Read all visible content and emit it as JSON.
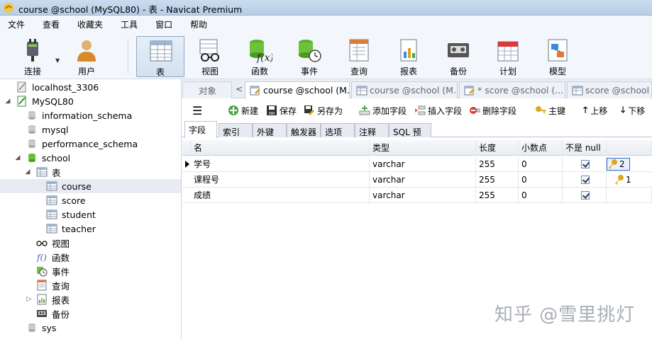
{
  "window": {
    "title": "course @school (MySQL80) - 表 - Navicat Premium"
  },
  "menu": [
    "文件",
    "查看",
    "收藏夹",
    "工具",
    "窗口",
    "帮助"
  ],
  "toolbar": {
    "connect": "连接",
    "user": "用户",
    "table": "表",
    "view": "视图",
    "function": "函数",
    "event": "事件",
    "query": "查询",
    "report": "报表",
    "backup": "备份",
    "schedule": "计划",
    "model": "模型"
  },
  "tree": {
    "localhost": "localhost_3306",
    "mysql80": "MySQL80",
    "dbs": [
      "information_schema",
      "mysql",
      "performance_schema"
    ],
    "school": "school",
    "tables_label": "表",
    "tables": [
      "course",
      "score",
      "student",
      "teacher"
    ],
    "views": "视图",
    "functions": "函数",
    "events": "事件",
    "queries": "查询",
    "reports": "报表",
    "backups": "备份",
    "sys": "sys"
  },
  "tabs": {
    "objects": "对象",
    "t1": "course @school (M...",
    "t2": "course @school (M...",
    "t3": "* score @school (...",
    "t4": "score @school (M"
  },
  "actions": {
    "new": "新建",
    "save": "保存",
    "save_as": "另存为",
    "add_field": "添加字段",
    "insert_field": "插入字段",
    "delete_field": "删除字段",
    "primary_key": "主键",
    "move_up": "上移",
    "move_down": "下移"
  },
  "subtabs": [
    "字段",
    "索引",
    "外键",
    "触发器",
    "选项",
    "注释",
    "SQL 预览"
  ],
  "grid": {
    "headers": {
      "name": "名",
      "type": "类型",
      "length": "长度",
      "decimals": "小数点",
      "not_null": "不是 null",
      "key": ""
    },
    "rows": [
      {
        "name": "学号",
        "type": "varchar",
        "length": "255",
        "decimals": "0",
        "key": "2"
      },
      {
        "name": "课程号",
        "type": "varchar",
        "length": "255",
        "decimals": "0",
        "key": "1"
      },
      {
        "name": "成绩",
        "type": "varchar",
        "length": "255",
        "decimals": "0",
        "key": ""
      }
    ]
  },
  "watermark": "知乎 @雪里挑灯",
  "colors": {
    "accent": "#2f64c2",
    "titlebar": "#c9dcef",
    "key": "#d9a21a"
  }
}
